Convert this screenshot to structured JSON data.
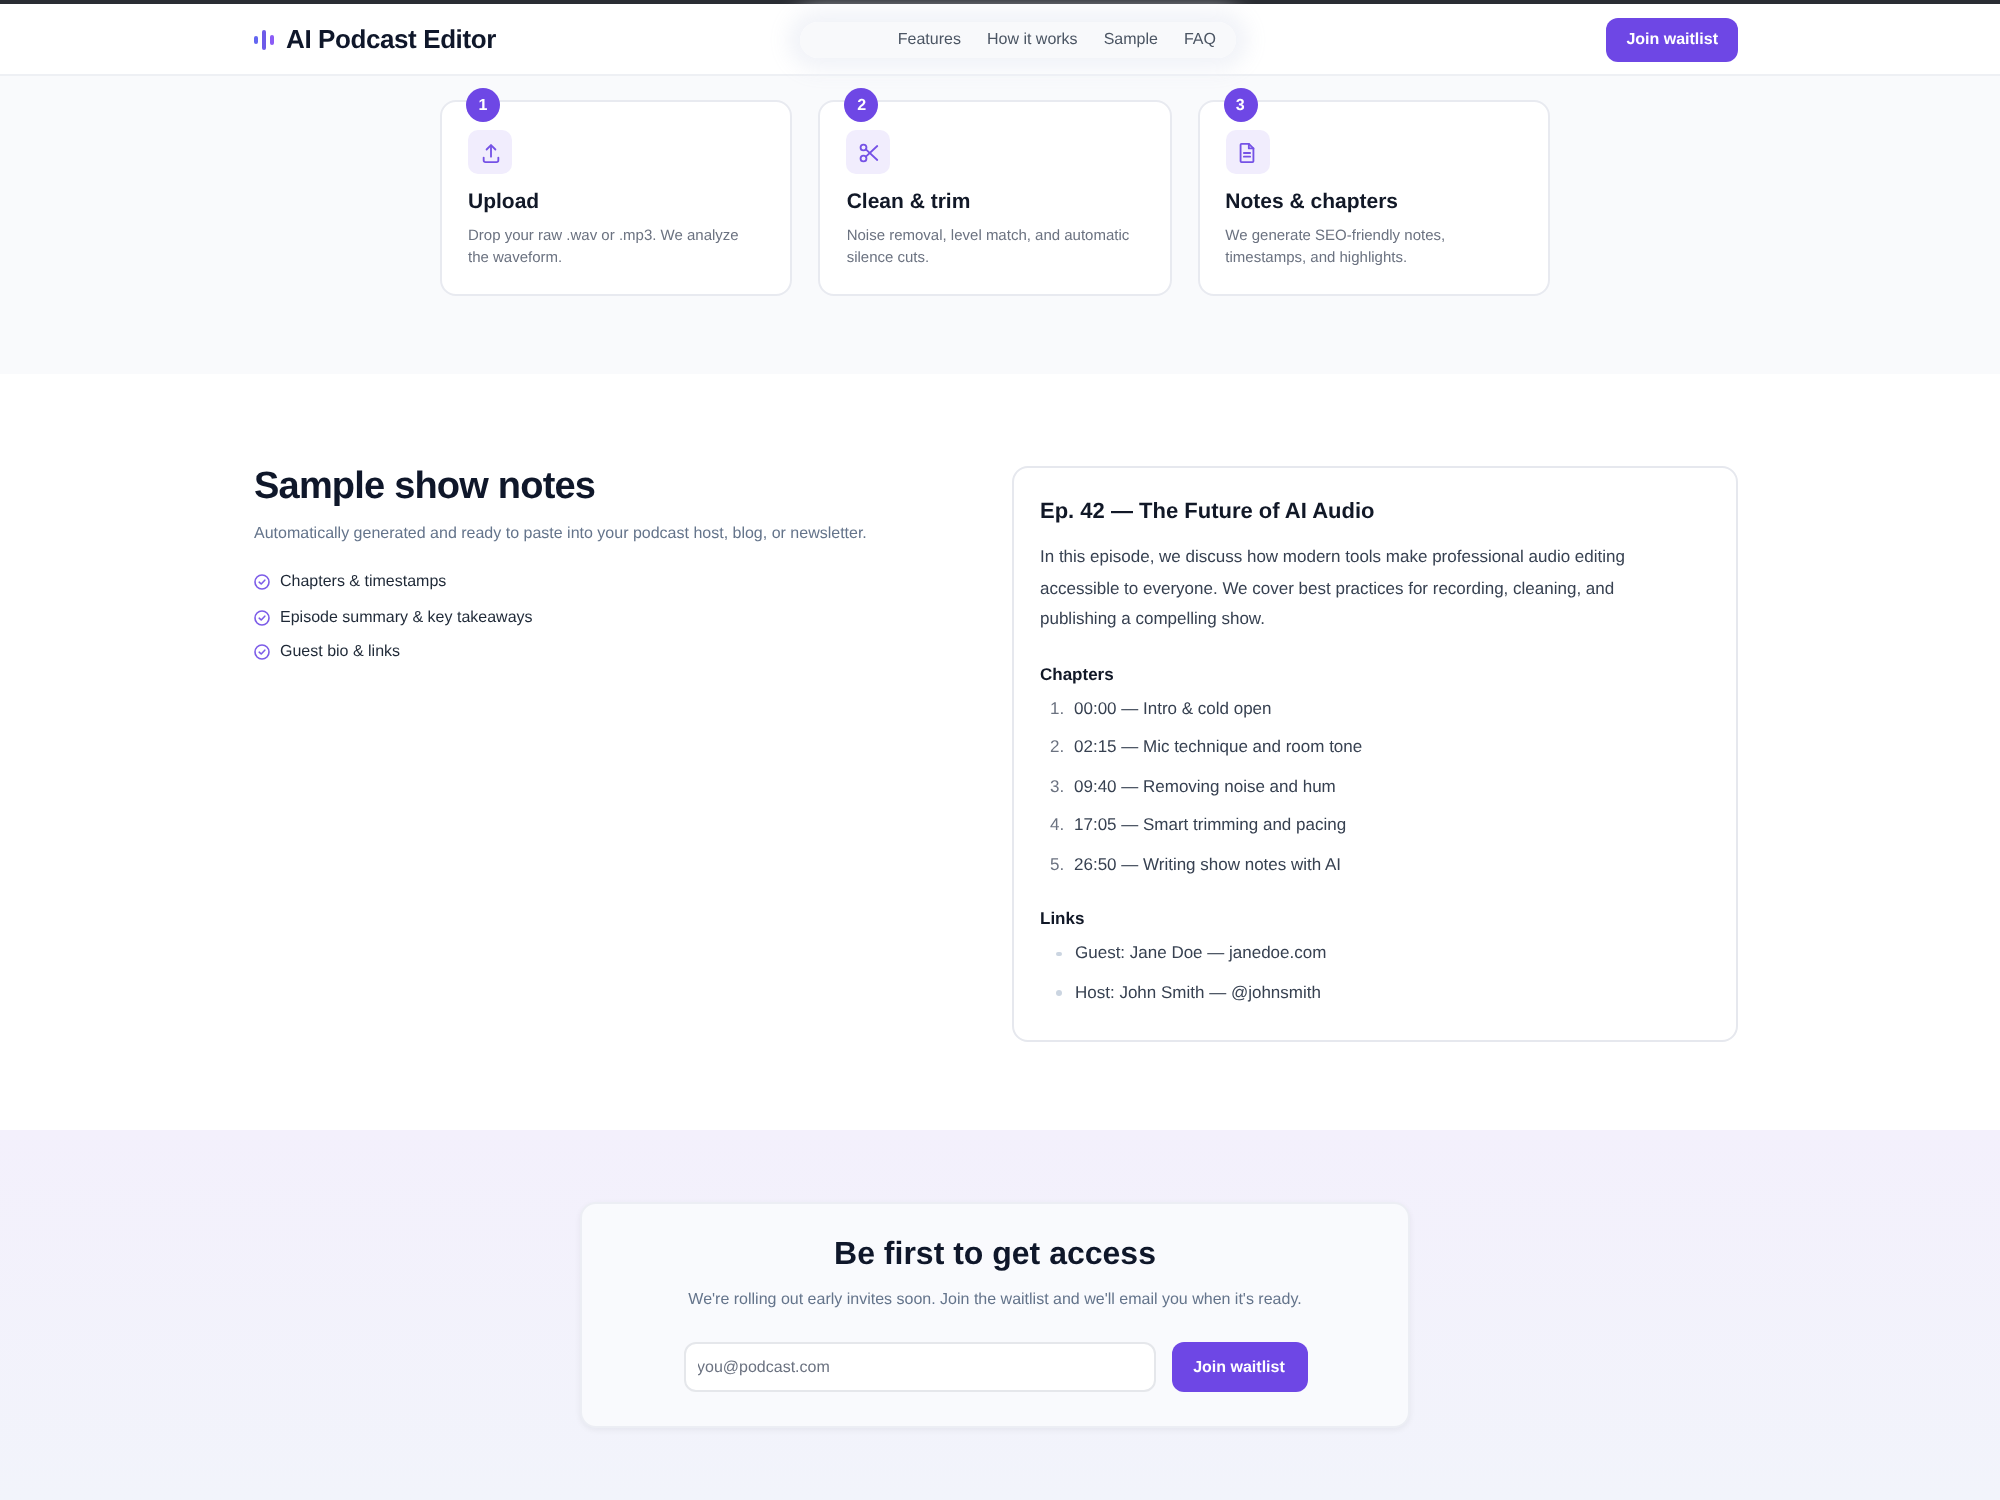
{
  "header": {
    "logo": "AI Podcast Editor",
    "nav": [
      "Features",
      "How it works",
      "Sample",
      "FAQ"
    ],
    "cta": "Join waitlist"
  },
  "steps": [
    {
      "number": "1",
      "kind": "upload",
      "title": "Upload",
      "description": "Drop your raw .wav or .mp3. We analyze the waveform."
    },
    {
      "number": "2",
      "kind": "clean",
      "title": "Clean & trim",
      "description": "Noise removal, level match, and automatic silence cuts."
    },
    {
      "number": "3",
      "kind": "notes",
      "title": "Notes & chapters",
      "description": "We generate SEO-friendly notes, timestamps, and highlights."
    }
  ],
  "sample": {
    "title": "Sample show notes",
    "subtitle": "Automatically generated and ready to paste into your podcast host, blog, or newsletter.",
    "features": [
      "Chapters & timestamps",
      "Episode summary & key takeaways",
      "Guest bio & links"
    ],
    "notes": {
      "title": "Ep. 42 — The Future of AI Audio",
      "summary": "In this episode, we discuss how modern tools make professional audio editing accessible to everyone. We cover best practices for recording, cleaning, and publishing a compelling show.",
      "sections": [
        {
          "kind": "ordered",
          "heading": "Chapters",
          "items": [
            {
              "number": "1.",
              "text": "00:00 — Intro & cold open"
            },
            {
              "number": "2.",
              "text": "02:15 — Mic technique and room tone"
            },
            {
              "number": "3.",
              "text": "09:40 — Removing noise and hum"
            },
            {
              "number": "4.",
              "text": "17:05 — Smart trimming and pacing"
            },
            {
              "number": "5.",
              "text": "26:50 — Writing show notes with AI"
            }
          ]
        },
        {
          "kind": "bulleted",
          "heading": "Links",
          "items": [
            {
              "text": "Guest: Jane Doe — janedoe.com"
            },
            {
              "text": "Host: John Smith — @johnsmith"
            }
          ]
        }
      ]
    }
  },
  "waitlist": {
    "title": "Be first to get access",
    "subtitle": "We're rolling out early invites soon. Join the waitlist and we'll email you when it's ready.",
    "email": {
      "placeholder": "you@podcast.com"
    },
    "button": "Join waitlist"
  }
}
